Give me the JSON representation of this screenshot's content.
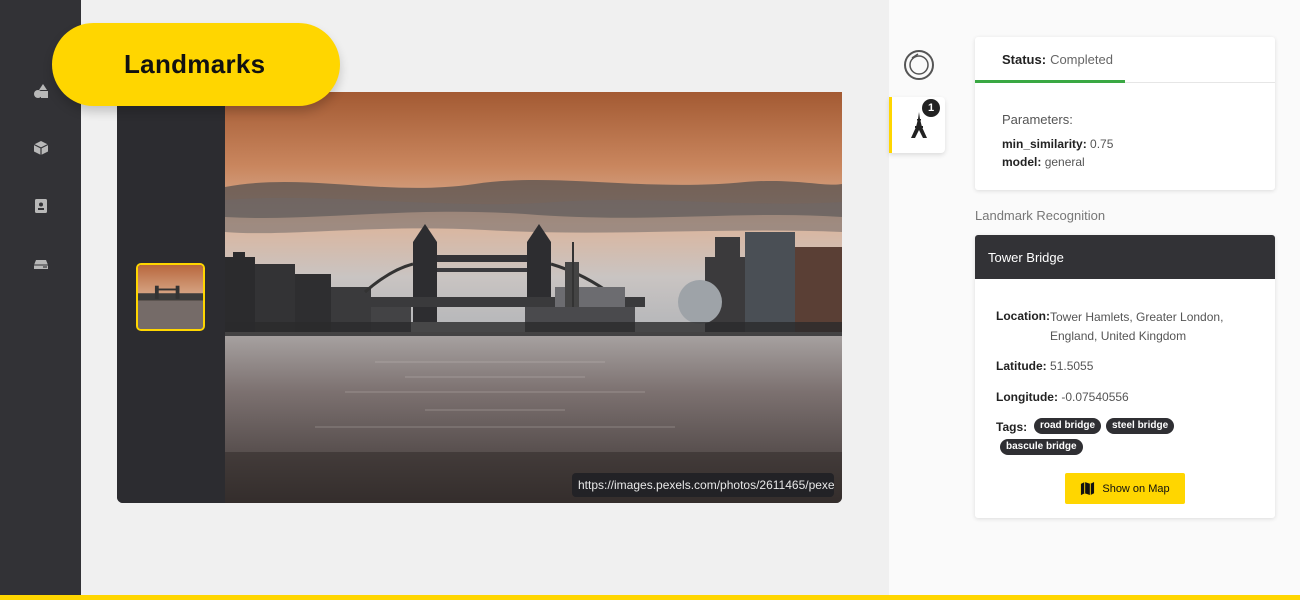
{
  "app": {
    "title": "Landmarks"
  },
  "nav": {
    "items": [
      {
        "icon": "shapes-icon"
      },
      {
        "icon": "cube-icon"
      },
      {
        "icon": "contact-book-icon"
      },
      {
        "icon": "storage-drive-icon"
      }
    ]
  },
  "viewer": {
    "image_url": "https://images.pexels.com/photos/2611465/pexel"
  },
  "tools": {
    "landmark_badge": "1"
  },
  "status": {
    "label": "Status:",
    "value": "Completed",
    "accent": "#3aa843"
  },
  "parameters": {
    "label": "Parameters:",
    "min_similarity_key": "min_similarity:",
    "min_similarity_value": "0.75",
    "model_key": "model:",
    "model_value": "general"
  },
  "recognition": {
    "section_title": "Landmark Recognition",
    "name": "Tower Bridge",
    "location_key": "Location:",
    "location_value": "Tower Hamlets, Greater London, England, United Kingdom",
    "latitude_key": "Latitude:",
    "latitude_value": "51.5055",
    "longitude_key": "Longitude:",
    "longitude_value": "-0.07540556",
    "tags_key": "Tags:",
    "tags": [
      "road bridge",
      "steel bridge",
      "bascule bridge"
    ],
    "map_button": "Show on Map"
  },
  "colors": {
    "accent_yellow": "#ffd600",
    "nav_dark": "#323236"
  }
}
